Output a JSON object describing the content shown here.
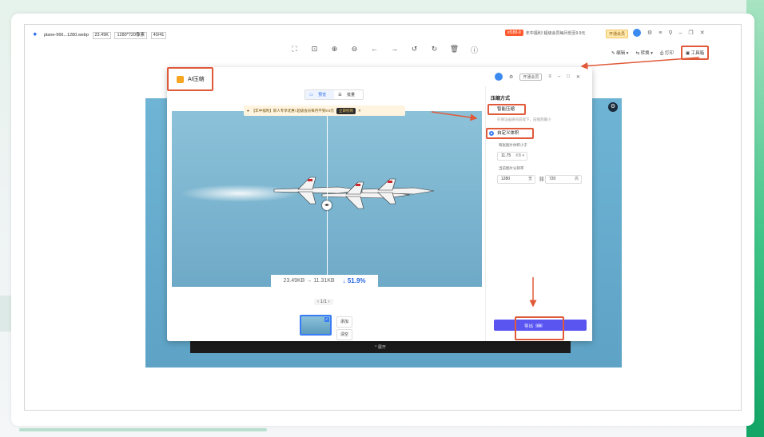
{
  "app": {
    "file_name": "plane-966...1280.webp",
    "file_size": "23.49K",
    "dimensions": "1280*720像素",
    "counter": "40/41",
    "promo_tag": "sf188-9",
    "promo_text": "年中福利! 超级会员每月低至9.9元",
    "vip_button": "开通会员"
  },
  "toolbar_right": {
    "edit": "编辑",
    "convert": "转换",
    "print": "打印",
    "toolbox": "工具箱"
  },
  "preview": {
    "collapse_label": "^ 展开"
  },
  "dialog": {
    "title": "AI压缩",
    "vip_button": "开通会员",
    "tabs": {
      "preview": "预览",
      "list": "批量"
    },
    "banner": {
      "text": "【年中福利】新人专享优惠! 超级会员每月不到9.9元",
      "buy": "立即抢购"
    },
    "size_before": "23.49KB",
    "arrow": "→",
    "size_after": "11.31KB",
    "reduction": "↓ 51.9%",
    "pager": "1/1",
    "add_label": "添加",
    "clear_label": "清空"
  },
  "panel": {
    "title": "压缩方式",
    "smart_label": "智能压缩",
    "smart_desc": "在保证画质的前提下，压缩到最小",
    "custom_label": "自定义体积",
    "target_label": "每张图片体积小于",
    "target_value": "11.75",
    "target_unit": "KB",
    "resolution_label": "当前图片分辨率",
    "width_value": "1280",
    "width_unit": "宽",
    "height_value": "720",
    "height_unit": "高",
    "export_label": "导出"
  }
}
